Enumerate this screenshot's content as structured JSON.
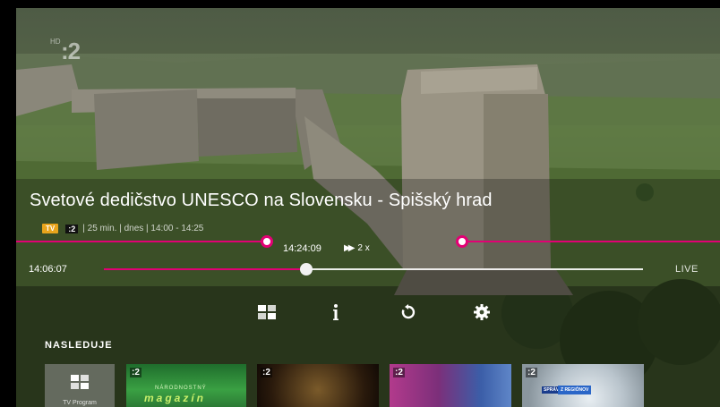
{
  "channel": {
    "hd": "HD",
    "logo": ":2"
  },
  "program": {
    "title": "Svetové dedičstvo UNESCO na Slovensku - Spišský hrad",
    "badge_tv": "TV",
    "badge_channel": ":2",
    "meta": "| 25 min. | dnes | 14:00 - 14:25"
  },
  "player": {
    "current_time": "14:24:09",
    "speed": "2 x",
    "start_time": "14:06:07",
    "live_label": "LIVE",
    "progress": 0.377
  },
  "controls": {
    "guide": "tv-guide-icon",
    "info": "info-icon",
    "restart": "restart-icon",
    "settings": "gear-icon"
  },
  "next": {
    "label": "NASLEDUJE",
    "guide_tile_label": "TV Program",
    "tiles": [
      {
        "channel": ":2",
        "line1": "NÁRODNOSTNÝ",
        "line2": "magazín"
      },
      {
        "channel": ":2"
      },
      {
        "channel": ":2"
      },
      {
        "channel": ":2",
        "tag1": "SPRÁVY",
        "tag2": "Z REGIÓNOV"
      }
    ]
  },
  "colors": {
    "accent": "#e20074",
    "badge": "#e8a41c"
  }
}
